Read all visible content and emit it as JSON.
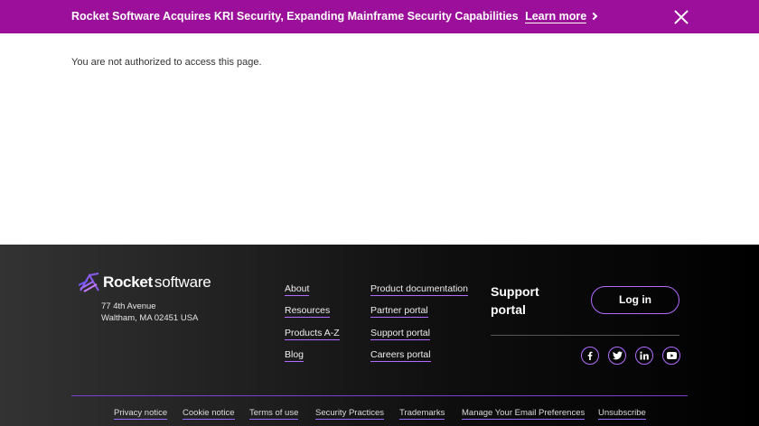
{
  "banner": {
    "text": "Rocket Software Acquires KRI Security, Expanding Mainframe Security Capabilities",
    "link": "Learn more",
    "close_icon": "close-icon",
    "color": "#9b0f9b"
  },
  "main": {
    "message": "You are not authorized to access this page."
  },
  "footer": {
    "logo": {
      "word1": "Rocket",
      "word2": "software"
    },
    "address": {
      "line1": "77 4th Avenue",
      "line2": "Waltham, MA 02451 USA"
    },
    "links_col1": [
      "About",
      "Resources",
      "Products A-Z",
      "Blog"
    ],
    "links_col2": [
      "Product documentation",
      "Partner portal",
      "Support portal",
      "Careers portal"
    ],
    "support": {
      "title": "Support portal",
      "login": "Log in"
    },
    "social": [
      "facebook-icon",
      "twitter-icon",
      "linkedin-icon",
      "youtube-icon"
    ],
    "bottom_links": [
      "Privacy notice",
      "Cookie notice",
      "Terms of use",
      "Security Practices",
      "Trademarks",
      "Manage Your Email Preferences",
      "Unsubscribe"
    ],
    "accent": "#b46bff"
  }
}
